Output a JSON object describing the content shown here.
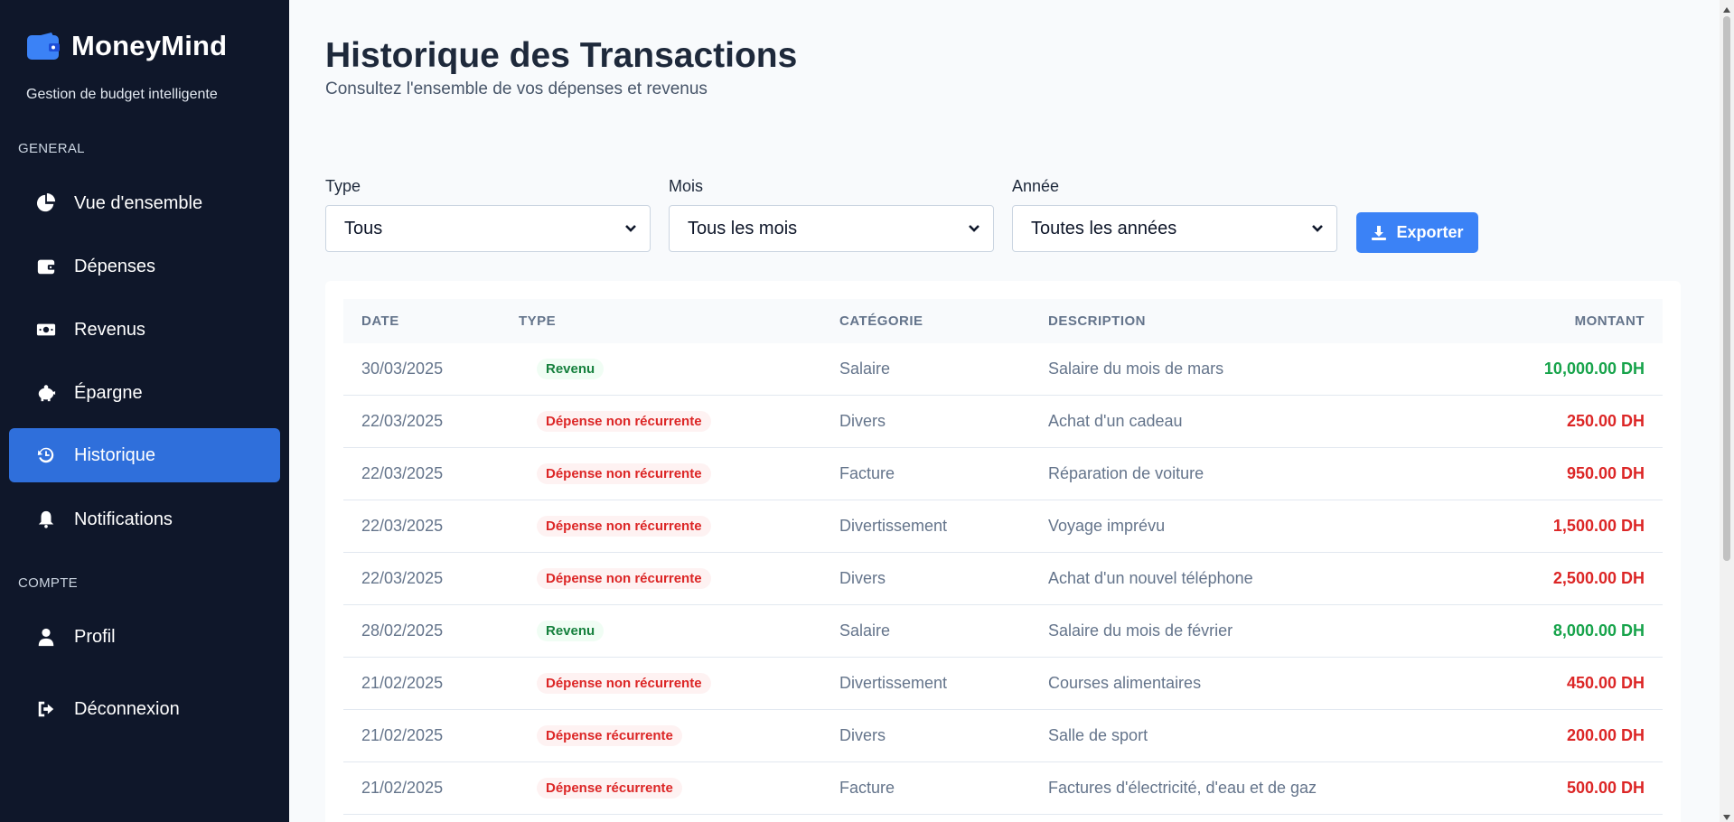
{
  "app": {
    "name": "MoneyMind",
    "tagline": "Gestion de budget intelligente",
    "brand_icon": "wallet-icon",
    "accent": "#2f6fdb"
  },
  "sidebar": {
    "section_general": "GENERAL",
    "section_account": "COMPTE",
    "items": [
      {
        "label": "Vue d'ensemble",
        "icon": "pie-chart-icon"
      },
      {
        "label": "Dépenses",
        "icon": "wallet-icon"
      },
      {
        "label": "Revenus",
        "icon": "money-bill-icon"
      },
      {
        "label": "Épargne",
        "icon": "piggy-bank-icon"
      },
      {
        "label": "Historique",
        "icon": "history-icon",
        "active": true
      },
      {
        "label": "Notifications",
        "icon": "bell-icon"
      },
      {
        "label": "Profil",
        "icon": "user-icon"
      },
      {
        "label": "Déconnexion",
        "icon": "logout-icon"
      }
    ]
  },
  "header": {
    "title": "Historique des Transactions",
    "subtitle": "Consultez l'ensemble de vos dépenses et revenus"
  },
  "filters": {
    "type": {
      "label": "Type",
      "value": "Tous"
    },
    "month": {
      "label": "Mois",
      "value": "Tous les mois"
    },
    "year": {
      "label": "Année",
      "value": "Toutes les années"
    },
    "export_label": "Exporter"
  },
  "table": {
    "columns": [
      "DATE",
      "TYPE",
      "CATÉGORIE",
      "DESCRIPTION",
      "MONTANT"
    ],
    "rows": [
      {
        "date": "30/03/2025",
        "type": "Revenu",
        "kind": "income",
        "category": "Salaire",
        "description": "Salaire du mois de mars",
        "amount": "10,000.00 DH"
      },
      {
        "date": "22/03/2025",
        "type": "Dépense non récurrente",
        "kind": "expense",
        "category": "Divers",
        "description": "Achat d'un cadeau",
        "amount": "250.00 DH"
      },
      {
        "date": "22/03/2025",
        "type": "Dépense non récurrente",
        "kind": "expense",
        "category": "Facture",
        "description": "Réparation de voiture",
        "amount": "950.00 DH"
      },
      {
        "date": "22/03/2025",
        "type": "Dépense non récurrente",
        "kind": "expense",
        "category": "Divertissement",
        "description": "Voyage imprévu",
        "amount": "1,500.00 DH"
      },
      {
        "date": "22/03/2025",
        "type": "Dépense non récurrente",
        "kind": "expense",
        "category": "Divers",
        "description": "Achat d'un nouvel téléphone",
        "amount": "2,500.00 DH"
      },
      {
        "date": "28/02/2025",
        "type": "Revenu",
        "kind": "income",
        "category": "Salaire",
        "description": "Salaire du mois de février",
        "amount": "8,000.00 DH"
      },
      {
        "date": "21/02/2025",
        "type": "Dépense non récurrente",
        "kind": "expense",
        "category": "Divertissement",
        "description": "Courses alimentaires",
        "amount": "450.00 DH"
      },
      {
        "date": "21/02/2025",
        "type": "Dépense récurrente",
        "kind": "expense",
        "category": "Divers",
        "description": "Salle de sport",
        "amount": "200.00 DH"
      },
      {
        "date": "21/02/2025",
        "type": "Dépense récurrente",
        "kind": "expense",
        "category": "Facture",
        "description": "Factures d'électricité, d'eau et de gaz",
        "amount": "500.00 DH"
      }
    ]
  },
  "colors": {
    "sidebar_bg": "#0f172a",
    "income": "#16a34a",
    "expense": "#dc2626",
    "export_button": "#3b82f6"
  }
}
